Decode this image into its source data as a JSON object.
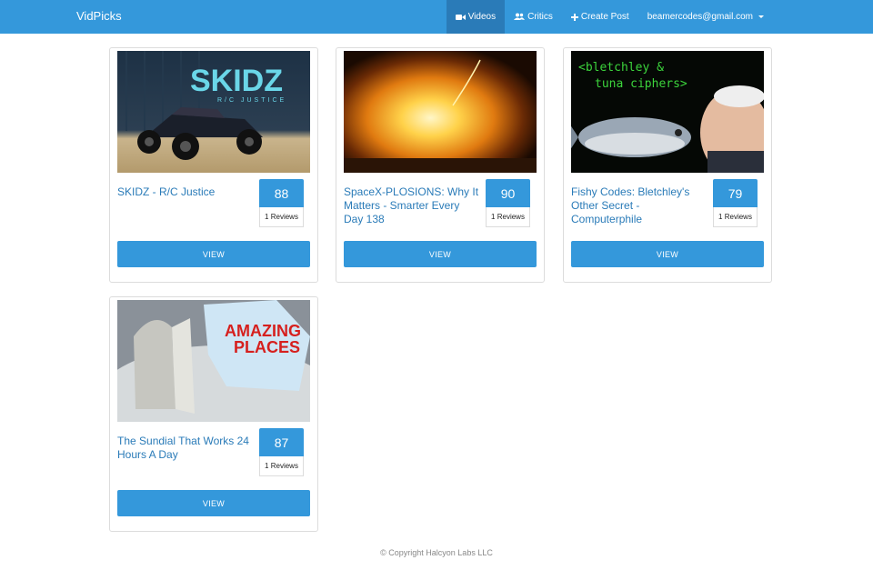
{
  "navbar": {
    "brand": "VidPicks",
    "items": [
      {
        "label": "Videos",
        "icon": "video-camera-icon"
      },
      {
        "label": "Critics",
        "icon": "users-icon"
      },
      {
        "label": "Create Post",
        "icon": "plus-icon"
      }
    ],
    "user_email": "beamercodes@gmail.com",
    "accent": "#3498db"
  },
  "videos": [
    {
      "title": "SKIDZ - R/C Justice",
      "score": "88",
      "reviews": "1 Reviews",
      "button": "VIEW",
      "thumb_text": "SKIDZ",
      "thumb_subtext": "R/C JUSTICE"
    },
    {
      "title": "SpaceX-PLOSIONS: Why It Matters - Smarter Every Day 138",
      "score": "90",
      "reviews": "1 Reviews",
      "button": "VIEW"
    },
    {
      "title": "Fishy Codes: Bletchley's Other Secret - Computerphile",
      "score": "79",
      "reviews": "1 Reviews",
      "button": "VIEW",
      "thumb_text": "<bletchley &",
      "thumb_subtext": "tuna ciphers>"
    },
    {
      "title": "The Sundial That Works 24 Hours A Day",
      "score": "87",
      "reviews": "1 Reviews",
      "button": "VIEW",
      "thumb_text": "AMAZING",
      "thumb_subtext": "PLACES"
    }
  ],
  "footer": "© Copyright Halcyon Labs LLC"
}
